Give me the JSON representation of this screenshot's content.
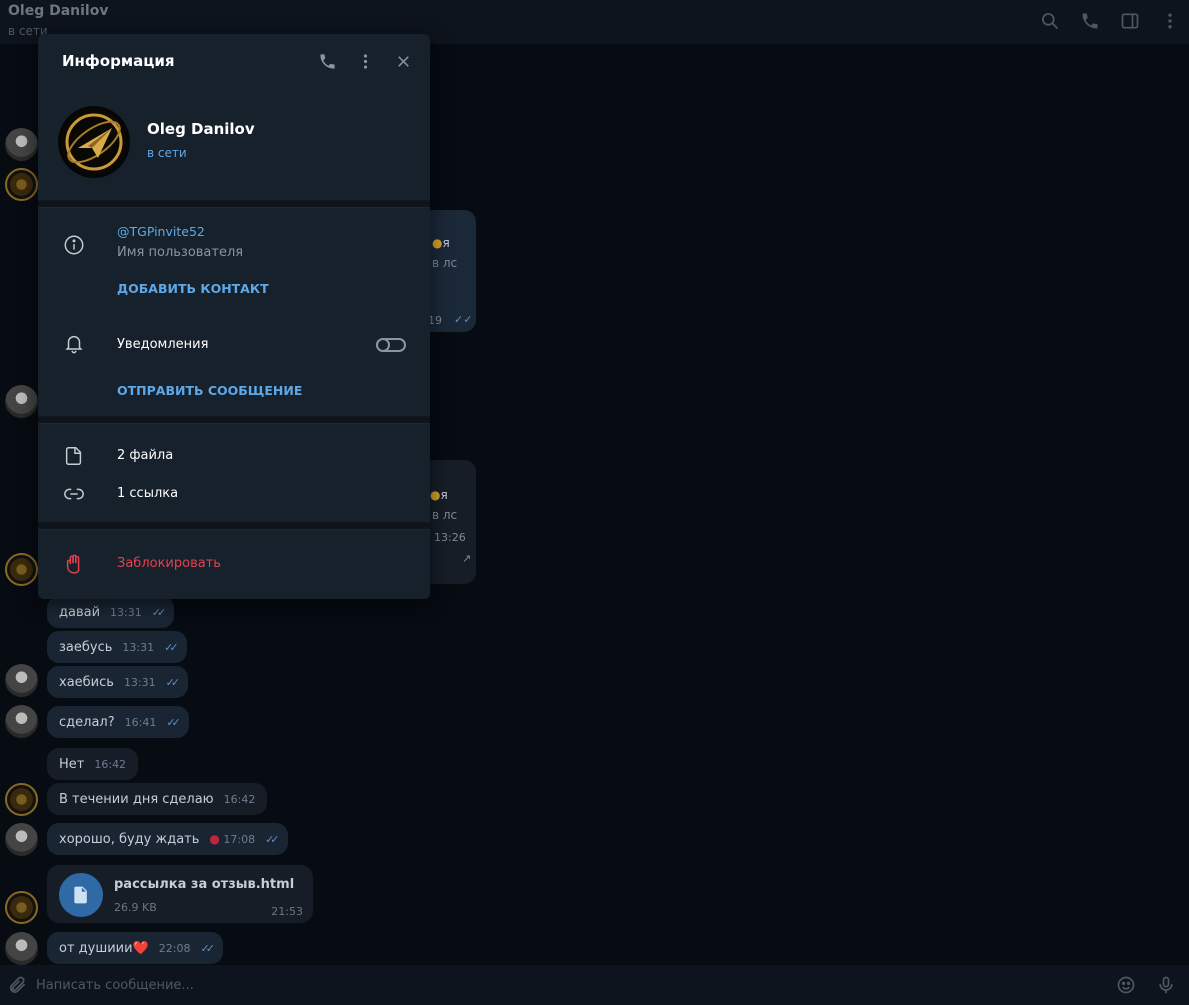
{
  "header": {
    "name": "Oleg Danilov",
    "status": "в сети"
  },
  "chat": {
    "partials": [
      {
        "text": "я",
        "sub": "в лс",
        "time": "19"
      },
      {
        "text": "я",
        "sub": "в лс",
        "time": "13:26"
      }
    ],
    "messages": [
      {
        "text": "давай",
        "time": "13:31"
      },
      {
        "text": "заебусь",
        "time": "13:31"
      },
      {
        "text": "хаебись",
        "time": "13:31"
      },
      {
        "text": "сделал?",
        "time": "16:41"
      },
      {
        "text": "Нет",
        "time": "16:42"
      },
      {
        "text": "В течении дня сделаю",
        "time": "16:42"
      },
      {
        "text": "хорошо, буду ждать",
        "time": "17:08"
      },
      {
        "text": "от душиии❤️",
        "time": "22:08"
      }
    ],
    "file": {
      "name": "рассылка за отзыв.html",
      "size": "26.9 KB",
      "time": "21:53"
    }
  },
  "composer": {
    "placeholder": "Написать сообщение..."
  },
  "info_panel": {
    "title": "Информация",
    "profile": {
      "name": "Oleg Danilov",
      "status": "в сети"
    },
    "username": "@TGPinvite52",
    "username_label": "Имя пользователя",
    "add_contact": "ДОБАВИТЬ КОНТАКТ",
    "notifications_label": "Уведомления",
    "notifications_on": false,
    "send_message": "ОТПРАВИТЬ СООБЩЕНИЕ",
    "files": "2 файла",
    "links": "1 ссылка",
    "block": "Заблокировать"
  }
}
